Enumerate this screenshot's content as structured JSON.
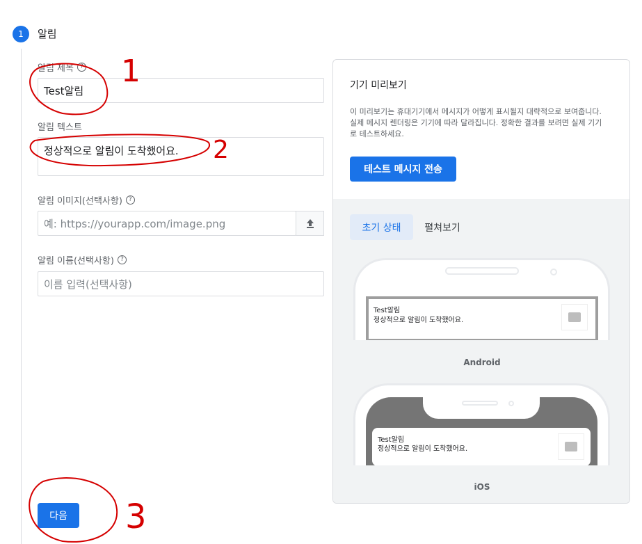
{
  "step": {
    "number": "1",
    "title": "알림"
  },
  "form": {
    "title_label": "알림 제목",
    "title_value": "Test알림",
    "text_label": "알림 텍스트",
    "text_value": "정상적으로 알림이 도착했어요.",
    "image_label": "알림 이미지(선택사항)",
    "image_placeholder": "예: https://yourapp.com/image.png",
    "name_label": "알림 이름(선택사항)",
    "name_placeholder": "이름 입력(선택사항)",
    "help_glyph": "?",
    "upload_icon": "upload-icon"
  },
  "next_button": "다음",
  "preview": {
    "title": "기기 미리보기",
    "description": "이 미리보기는 휴대기기에서 메시지가 어떻게 표시될지 대략적으로 보여줍니다. 실제 메시지 렌더링은 기기에 따라 달라집니다. 정확한 결과를 보려면 실제 기기로 테스트하세요.",
    "send_test_button": "테스트 메시지 전송",
    "tabs": [
      {
        "label": "초기 상태",
        "active": true
      },
      {
        "label": "펼쳐보기",
        "active": false
      }
    ],
    "android": {
      "label": "Android",
      "notif_title": "Test알림",
      "notif_text": "정상적으로 알림이 도착했어요."
    },
    "ios": {
      "label": "iOS",
      "notif_title": "Test알림",
      "notif_text": "정상적으로 알림이 도착했어요."
    }
  },
  "annotations": [
    "1",
    "2",
    "3"
  ],
  "colors": {
    "accent": "#1a73e8",
    "annotation": "#d50000",
    "panel_bg": "#f1f3f4",
    "tab_active_bg": "#e2ebf8"
  }
}
